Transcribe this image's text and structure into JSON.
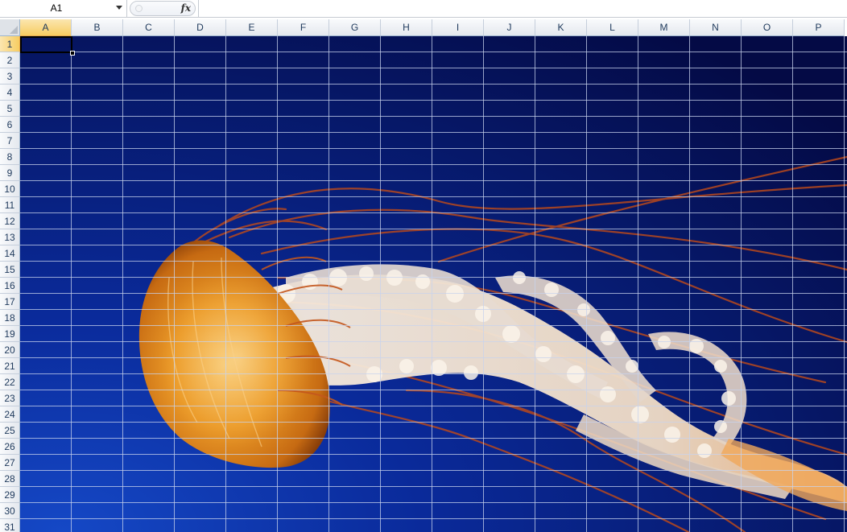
{
  "formula_bar": {
    "name_box": "A1",
    "fx_label": "fx",
    "formula_value": ""
  },
  "sheet": {
    "columns": [
      "A",
      "B",
      "C",
      "D",
      "E",
      "F",
      "G",
      "H",
      "I",
      "J",
      "K",
      "L",
      "M",
      "N",
      "O",
      "P"
    ],
    "rows": [
      "1",
      "2",
      "3",
      "4",
      "5",
      "6",
      "7",
      "8",
      "9",
      "10",
      "11",
      "12",
      "13",
      "14",
      "15",
      "16",
      "17",
      "18",
      "19",
      "20",
      "21",
      "22",
      "23",
      "24",
      "25",
      "26",
      "27",
      "28",
      "29",
      "30",
      "31"
    ],
    "active_column": "A",
    "active_row": "1",
    "background_picture": "jellyfish-photo"
  },
  "colors": {
    "sea_dark": "#040a45",
    "sea_mid": "#0a2a9a",
    "sea_light": "#1548c6",
    "jelly_bell": "#e48e1e",
    "jelly_glow": "#f7b851",
    "tentacle_white": "#f5ece0",
    "tentacle_red": "#b8491c",
    "gridline": "#c8d3ec"
  }
}
